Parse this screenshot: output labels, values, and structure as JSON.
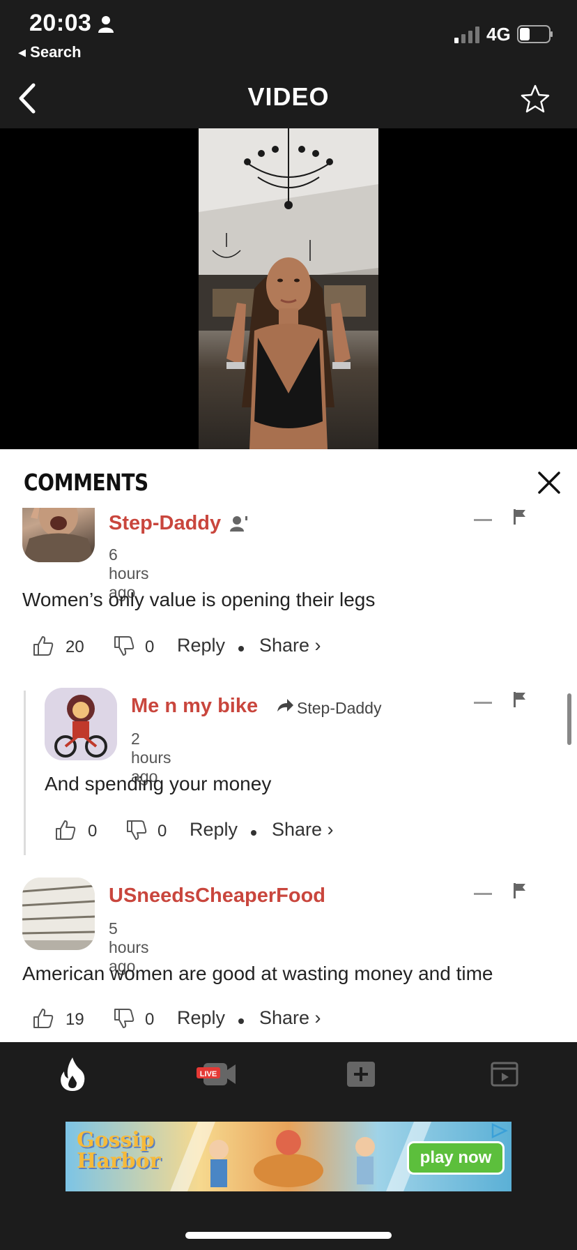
{
  "status_bar": {
    "time": "20:03",
    "back_app": "◂ Search",
    "network": "4G"
  },
  "nav": {
    "title": "VIDEO"
  },
  "comments": {
    "title": "COMMENTS",
    "items": [
      {
        "username": "Step-Daddy",
        "timestamp": "6 hours ago",
        "text": "Women’s only value is opening their legs",
        "likes": "20",
        "dislikes": "0",
        "reply_label": "Reply",
        "share_label": "Share ›"
      },
      {
        "username": "Me n my bike",
        "reply_to": "Step-Daddy",
        "timestamp": "2 hours ago",
        "text": "And spending your money",
        "likes": "0",
        "dislikes": "0",
        "reply_label": "Reply",
        "share_label": "Share ›"
      },
      {
        "username": "USneedsCheaperFood",
        "timestamp": "5 hours ago",
        "text": "American women are good at wasting money and time",
        "likes": "19",
        "dislikes": "0",
        "reply_label": "Reply",
        "share_label": "Share ›"
      }
    ]
  },
  "tabbar": {
    "live_badge": "LIVE"
  },
  "ad": {
    "brand_line1": "Gossip",
    "brand_line2": "Harbor",
    "cta": "play now"
  },
  "colors": {
    "username": "#c9463d",
    "bar_bg": "#1c1c1c",
    "ad_cta": "#5cbf3c"
  }
}
